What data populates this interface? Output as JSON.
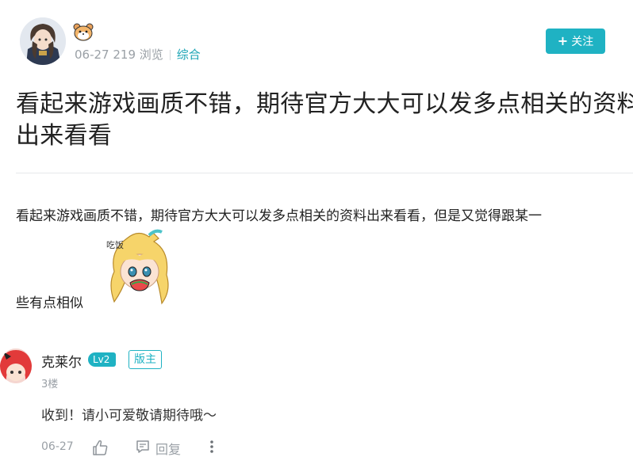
{
  "post": {
    "author_emoji": "hamster-icon",
    "date": "06-27",
    "views": "219 浏览",
    "category": "综合",
    "follow_label": "关注",
    "title": "看起来游戏画质不错，期待官方大大可以发多点相关的资料出来看看",
    "body_line1": "看起来游戏画质不错，期待官方大大可以发多点相关的资料出来看看，但是又觉得跟某一",
    "body_line2": "些有点相似"
  },
  "comment": {
    "author": "克莱尔",
    "level": "Lv2",
    "role": "版主",
    "floor": "3楼",
    "text": "收到！请小可爱敬请期待哦～",
    "date": "06-27",
    "reply_label": "回复"
  },
  "colors": {
    "accent": "#1fb2c3",
    "muted": "#9aa0a6"
  }
}
